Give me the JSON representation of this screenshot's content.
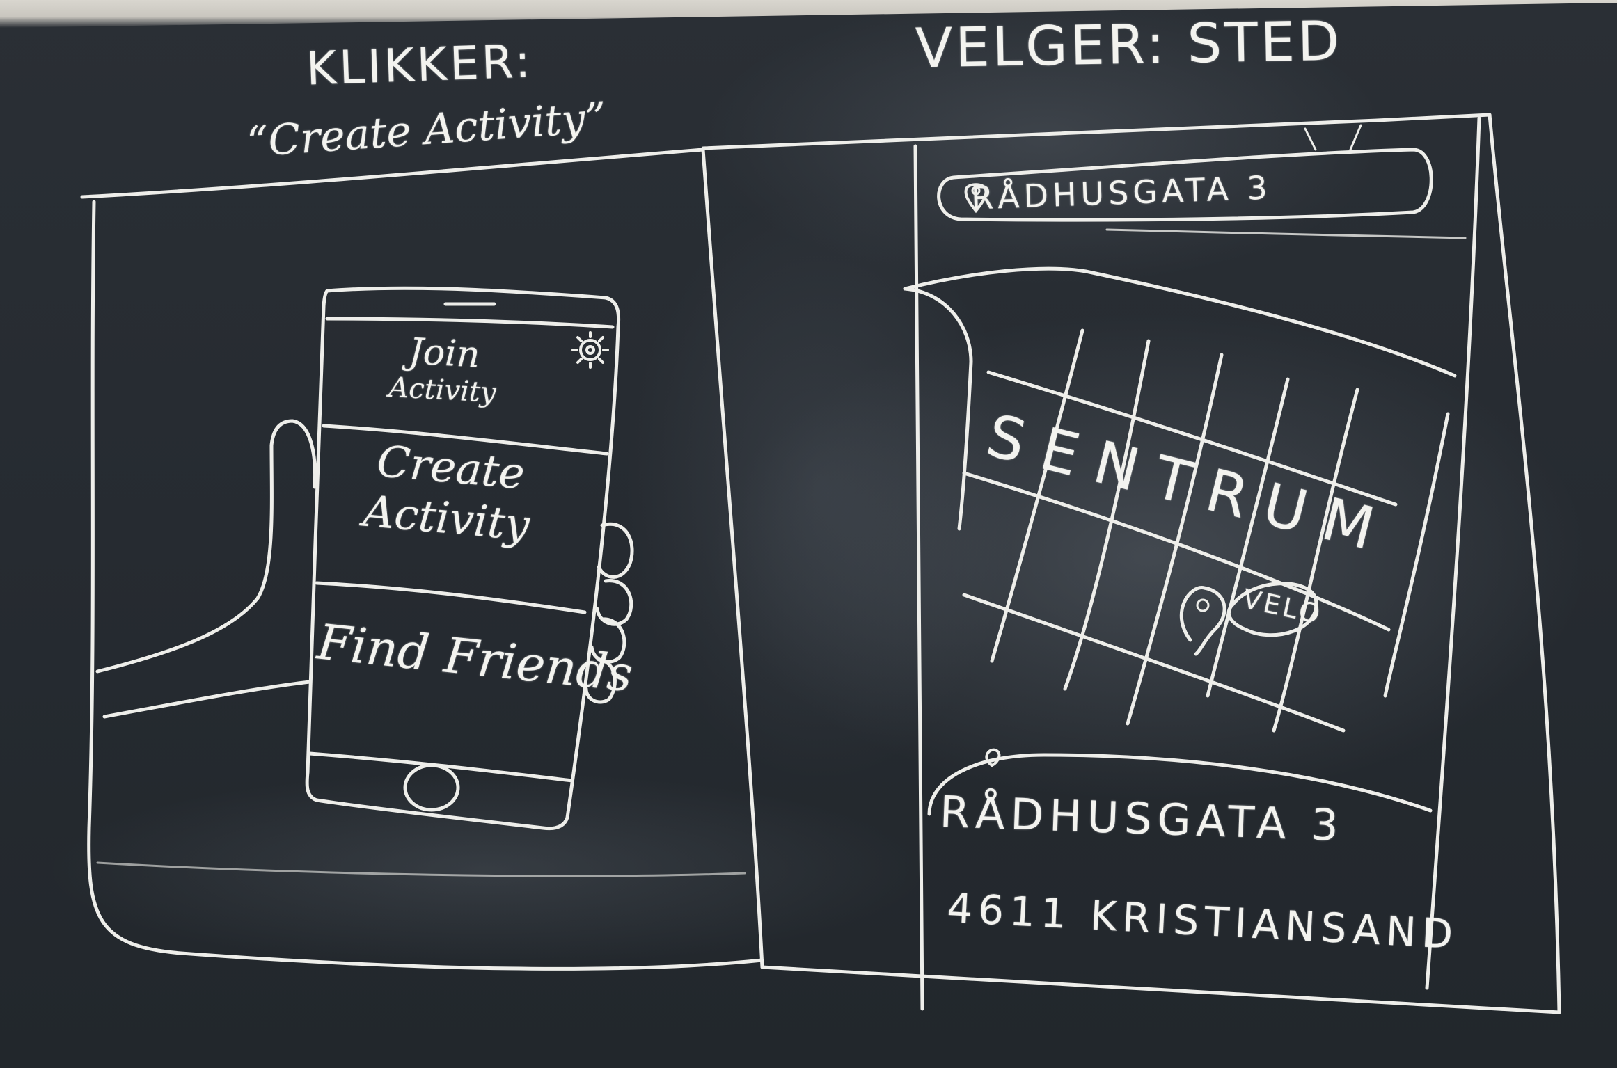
{
  "left_panel": {
    "heading": "KLIKKER:",
    "subheading": "“Create Activity”",
    "phone": {
      "menu_items": [
        {
          "line1": "Join",
          "line2": "Activity"
        },
        {
          "line1": "Create",
          "line2": "Activity"
        },
        {
          "line1": "Find Friends",
          "line2": ""
        }
      ],
      "settings_icon": "gear-icon",
      "home_button_icon": "home-button-icon"
    }
  },
  "right_panel": {
    "heading": "VELGER: STED",
    "search": {
      "icon": "location-pin-icon",
      "value": "RÅDHUSGATA  3"
    },
    "map": {
      "area_label": "SENTRUM",
      "pin_icon": "location-pin-icon",
      "pin_label": "VELO"
    },
    "address_card": {
      "icon": "location-pin-icon",
      "line1": "RÅDHUSGATA   3",
      "line2": "4611 KRISTIANSAND"
    }
  },
  "colors": {
    "board": "#262b31",
    "chalk": "#f3f3ef"
  }
}
